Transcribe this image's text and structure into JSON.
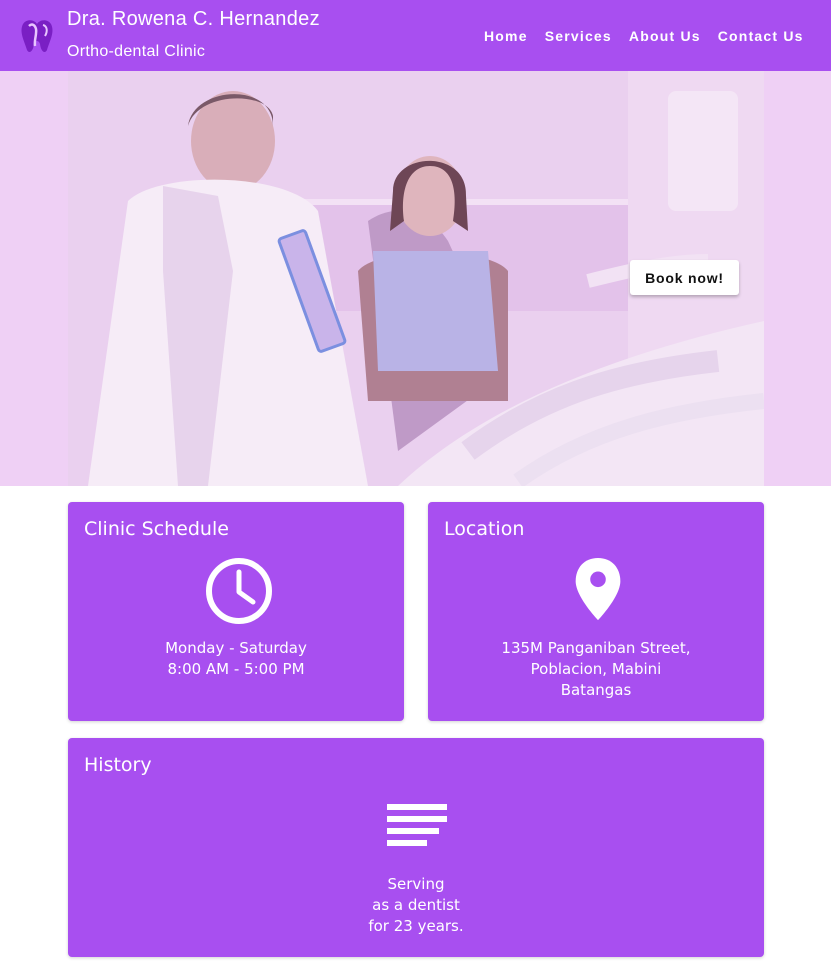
{
  "header": {
    "title": "Dra. Rowena C. Hernandez",
    "subtitle": "Ortho-dental Clinic",
    "logo_icon": "tooth-icon",
    "nav": [
      "Home",
      "Services",
      "About Us",
      "Contact Us"
    ]
  },
  "hero": {
    "book_label": "Book now!"
  },
  "schedule": {
    "title": "Clinic Schedule",
    "icon": "clock-icon",
    "lines": [
      "Monday - Saturday",
      "8:00 AM - 5:00 PM"
    ]
  },
  "location": {
    "title": "Location",
    "icon": "map-pin-icon",
    "lines": [
      "135M Panganiban Street,",
      "Poblacion, Mabini",
      "Batangas"
    ]
  },
  "history": {
    "title": "History",
    "icon": "text-lines-icon",
    "lines": [
      "Serving",
      "as a dentist",
      "for 23 years."
    ]
  },
  "colors": {
    "primary": "#a84ff0",
    "hero_overlay": "#efd0f5"
  }
}
